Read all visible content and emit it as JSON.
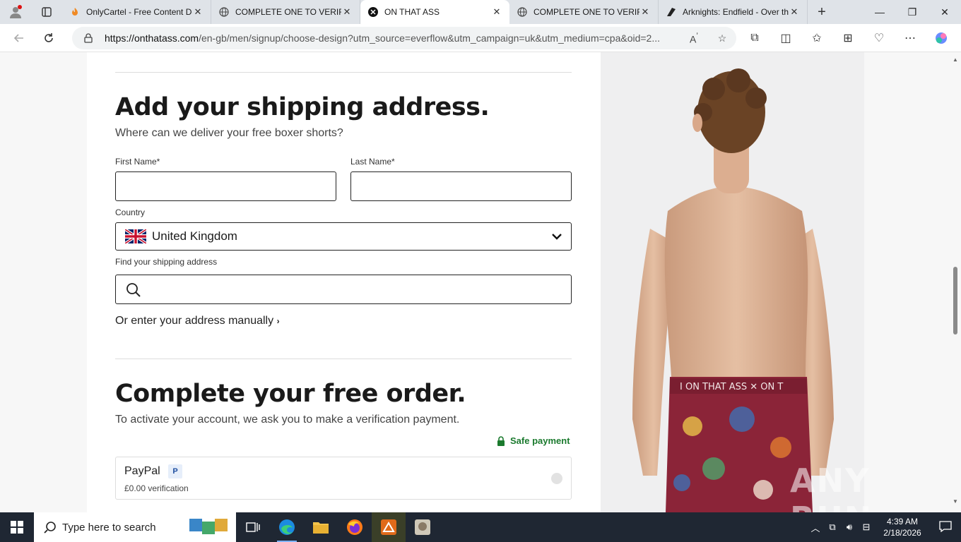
{
  "browser": {
    "tabs": [
      {
        "title": "OnlyCartel - Free Content Do",
        "active": false,
        "favicon": "flame-icon"
      },
      {
        "title": "COMPLETE ONE TO VERIFY",
        "active": false,
        "favicon": "globe-icon"
      },
      {
        "title": "ON THAT ASS",
        "active": true,
        "favicon": "ota-logo-icon"
      },
      {
        "title": "COMPLETE ONE TO VERIFY",
        "active": false,
        "favicon": "globe-icon"
      },
      {
        "title": "Arknights: Endfield - Over th",
        "active": false,
        "favicon": "arknights-icon"
      }
    ],
    "url_domain": "https://onthatass.com",
    "url_path": "/en-gb/men/signup/choose-design?utm_source=everflow&utm_campaign=uk&utm_medium=cpa&oid=2..."
  },
  "page": {
    "shipping": {
      "title": "Add your shipping address.",
      "subtitle": "Where can we deliver your free boxer shorts?",
      "first_name_label": "First Name*",
      "last_name_label": "Last Name*",
      "country_label": "Country",
      "country_value": "United Kingdom",
      "find_label": "Find your shipping address",
      "manual_link": "Or enter your address manually"
    },
    "order": {
      "title": "Complete your free order.",
      "subtitle": "To activate your account, we ask you to make a verification payment.",
      "safe_payment": "Safe payment",
      "payment_method": "PayPal",
      "payment_note": "£0.00 verification"
    },
    "waistband_text": "I ON THAT ASS  ✕  ON T"
  },
  "watermark": "ANY RUN",
  "taskbar": {
    "search_placeholder": "Type here to search",
    "time": "4:39 AM",
    "date": "2/18/2026"
  }
}
